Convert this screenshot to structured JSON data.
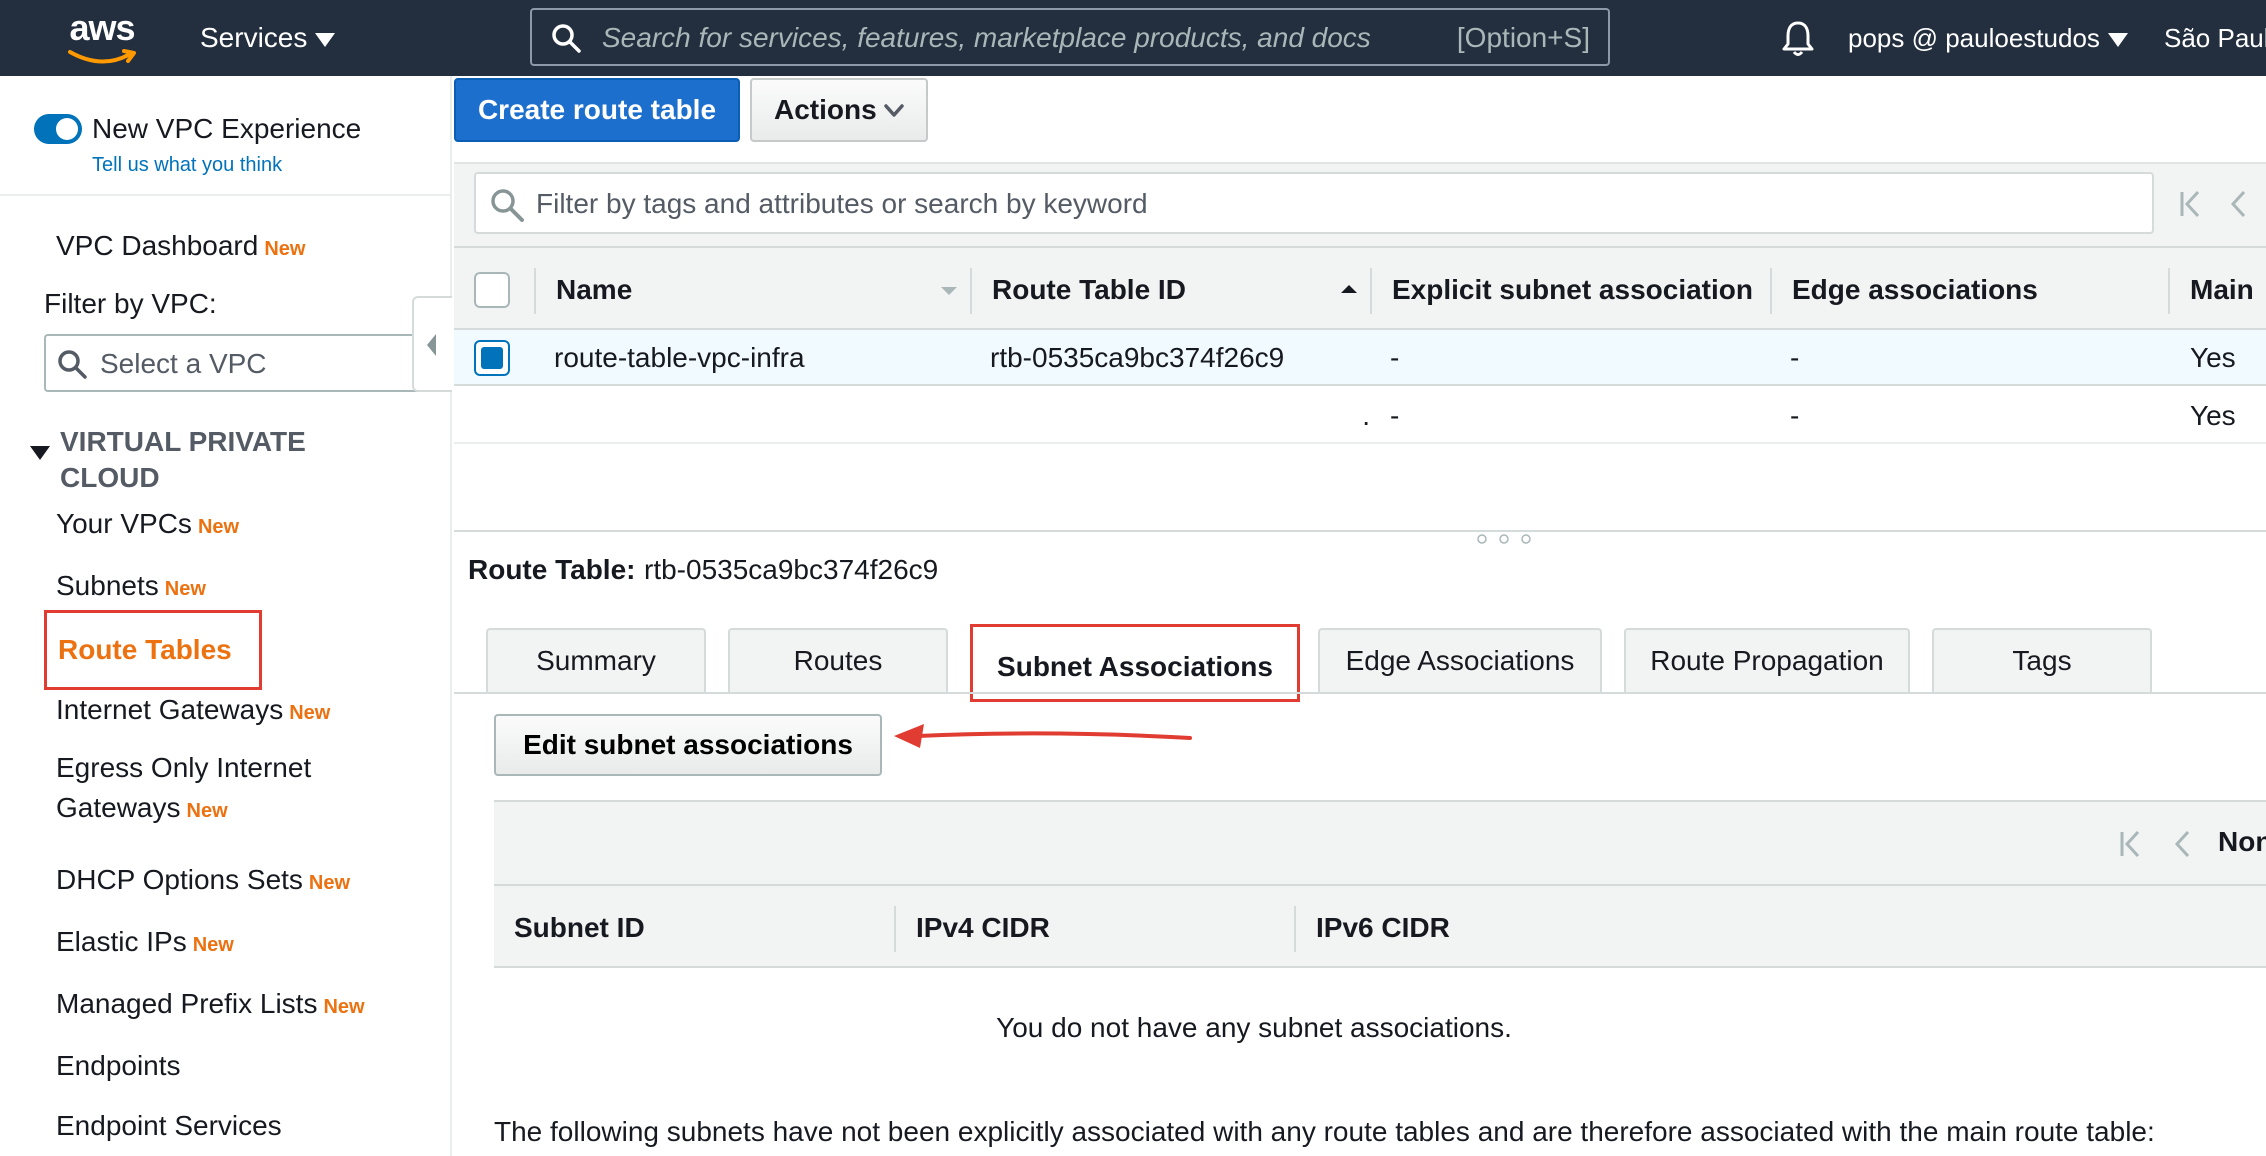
{
  "topbar": {
    "logo_text": "aws",
    "services_label": "Services",
    "search_placeholder": "Search for services, features, marketplace products, and docs",
    "search_shortcut": "[Option+S]",
    "user_label": "pops @ pauloestudos",
    "region_label": "São Paulo"
  },
  "sidebar": {
    "toggle_label": "New VPC Experience",
    "feedback_link": "Tell us what you think",
    "dashboard": {
      "label": "VPC Dashboard",
      "badge": "New"
    },
    "filter_label": "Filter by VPC:",
    "vpc_select_placeholder": "Select a VPC",
    "section_heading": "VIRTUAL PRIVATE CLOUD",
    "items": [
      {
        "label": "Your VPCs",
        "badge": "New"
      },
      {
        "label": "Subnets",
        "badge": "New"
      },
      {
        "label": "Route Tables",
        "badge": ""
      },
      {
        "label": "Internet Gateways",
        "badge": "New"
      },
      {
        "label": "Egress Only Internet Gateways",
        "badge": "New"
      },
      {
        "label": "DHCP Options Sets",
        "badge": "New"
      },
      {
        "label": "Elastic IPs",
        "badge": "New"
      },
      {
        "label": "Managed Prefix Lists",
        "badge": "New"
      },
      {
        "label": "Endpoints",
        "badge": ""
      },
      {
        "label": "Endpoint Services",
        "badge": ""
      }
    ]
  },
  "toolbar": {
    "create_label": "Create route table",
    "actions_label": "Actions"
  },
  "filter": {
    "placeholder": "Filter by tags and attributes or search by keyword"
  },
  "grid": {
    "columns": [
      "Name",
      "Route Table ID",
      "Explicit subnet association",
      "Edge associations",
      "Main"
    ],
    "rows": [
      {
        "name": "route-table-vpc-infra",
        "id": "rtb-0535ca9bc374f26c9",
        "explicit": "-",
        "edge": "-",
        "main": "Yes",
        "selected": true
      },
      {
        "name": "",
        "id": ".",
        "explicit": "-",
        "edge": "-",
        "main": "Yes",
        "selected": false
      }
    ]
  },
  "detail": {
    "label": "Route Table:",
    "value": "rtb-0535ca9bc374f26c9",
    "tabs": [
      "Summary",
      "Routes",
      "Subnet Associations",
      "Edge Associations",
      "Route Propagation",
      "Tags"
    ],
    "active_tab": "Subnet Associations",
    "edit_button": "Edit subnet associations",
    "pager_text": "None",
    "sub_columns": [
      "Subnet ID",
      "IPv4 CIDR",
      "IPv6 CIDR"
    ],
    "empty_message": "You do not have any subnet associations.",
    "footnote": "The following subnets have not been explicitly associated with any route tables and are therefore associated with the main route table:"
  },
  "colors": {
    "topbar_bg": "#232f3e",
    "primary_button": "#1d6fcd",
    "accent_orange": "#ec7211",
    "annotation_red": "#e03c31",
    "link_blue": "#0073bb"
  },
  "icons": {
    "search": "search-icon",
    "bell": "bell-icon",
    "caret": "caret-down-icon",
    "collapse": "chevron-left-icon",
    "first_page": "first-page-icon",
    "prev_page": "chevron-left-icon",
    "sort_asc": "sort-ascending-icon",
    "sort_desc": "sort-descending-icon"
  }
}
